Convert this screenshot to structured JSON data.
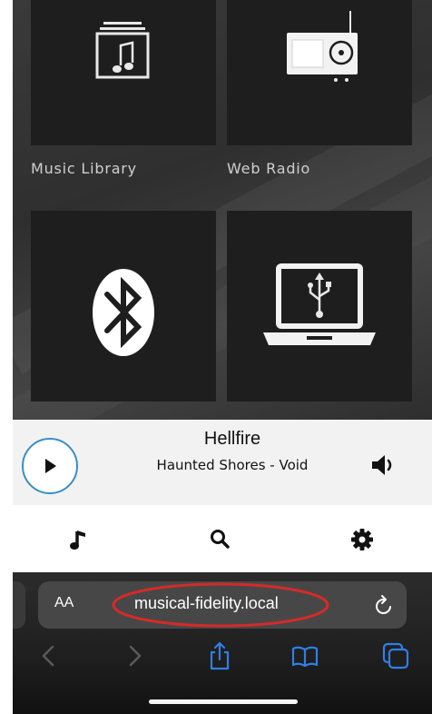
{
  "sources": [
    {
      "label": "Music Library",
      "icon": "music-library-icon"
    },
    {
      "label": "Web Radio",
      "icon": "radio-icon"
    },
    {
      "label": "",
      "icon": "bluetooth-icon"
    },
    {
      "label": "",
      "icon": "usb-laptop-icon"
    }
  ],
  "now_playing": {
    "title": "Hellfire",
    "subtitle": "Haunted Shores - Void",
    "play_icon": "play-icon",
    "volume_icon": "speaker-icon",
    "accent_color": "#3a8fc4"
  },
  "tab_bar": {
    "items": [
      {
        "icon": "music-note-icon"
      },
      {
        "icon": "search-icon"
      },
      {
        "icon": "gear-icon"
      }
    ]
  },
  "browser": {
    "text_size_label": "AA",
    "url": "musical-fidelity.local",
    "highlight_color": "#d42a2a",
    "toolbar": [
      "back-icon",
      "forward-icon",
      "share-icon",
      "bookmarks-icon",
      "tabs-icon"
    ],
    "accent_color": "#2f7fe8"
  }
}
